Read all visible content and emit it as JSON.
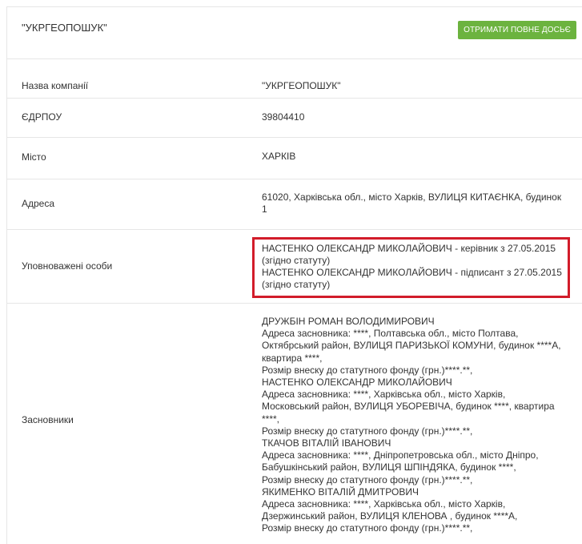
{
  "header": {
    "title": "\"УКРГЕОПОШУК\"",
    "button_label": "ОТРИМАТИ ПОВНЕ ДОСЬЄ",
    "button_color": "#6cb33f"
  },
  "rows": {
    "name": {
      "label": "Назва компанії",
      "value": "\"УКРГЕОПОШУК\""
    },
    "edrpou": {
      "label": "ЄДРПОУ",
      "value": "39804410"
    },
    "city": {
      "label": "Місто",
      "value": "ХАРКІВ"
    },
    "address": {
      "label": "Адреса",
      "lines": [
        "61020, Харківська обл., місто Харків, ВУЛИЦЯ КИТАЄНКА, будинок",
        "1"
      ]
    },
    "authorized": {
      "label": "Уповноважені особи",
      "lines": [
        "НАСТЕНКО ОЛЕКСАНДР МИКОЛАЙОВИЧ - керівник з 27.05.2015",
        "(згідно статуту)",
        "НАСТЕНКО ОЛЕКСАНДР МИКОЛАЙОВИЧ - підписант з 27.05.2015",
        "(згідно статуту)"
      ],
      "highlight_color": "#d21c2a"
    },
    "founders": {
      "label": "Засновники",
      "lines": [
        "ДРУЖБІН РОМАН ВОЛОДИМИРОВИЧ",
        "Адреса засновника: ****, Полтавська обл., місто Полтава,",
        "Октябрський район, ВУЛИЦЯ ПАРИЗЬКОЇ КОМУНИ, будинок ****А,",
        "квартира ****,",
        "Розмір внеску до статутного фонду (грн.)****.**,",
        "НАСТЕНКО ОЛЕКСАНДР МИКОЛАЙОВИЧ",
        "Адреса засновника: ****, Харківська обл., місто Харків,",
        "Московський район, ВУЛИЦЯ УБОРЕВІЧА, будинок ****, квартира",
        "****,",
        "Розмір внеску до статутного фонду (грн.)****.**,",
        "ТКАЧОВ ВІТАЛІЙ ІВАНОВИЧ",
        "Адреса засновника: ****, Дніпропетровська обл., місто Дніпро,",
        "Бабушкінський район, ВУЛИЦЯ ШПІНДЯКА, будинок ****,",
        "Розмір внеску до статутного фонду (грн.)****.**,",
        "ЯКИМЕНКО ВІТАЛІЙ ДМИТРОВИЧ",
        "Адреса засновника: ****, Харківська обл., місто Харків,",
        "Дзержинський район, ВУЛИЦЯ КЛЕНОВА , будинок ****А,",
        "Розмір внеску до статутного фонду (грн.)****.**,"
      ]
    }
  }
}
